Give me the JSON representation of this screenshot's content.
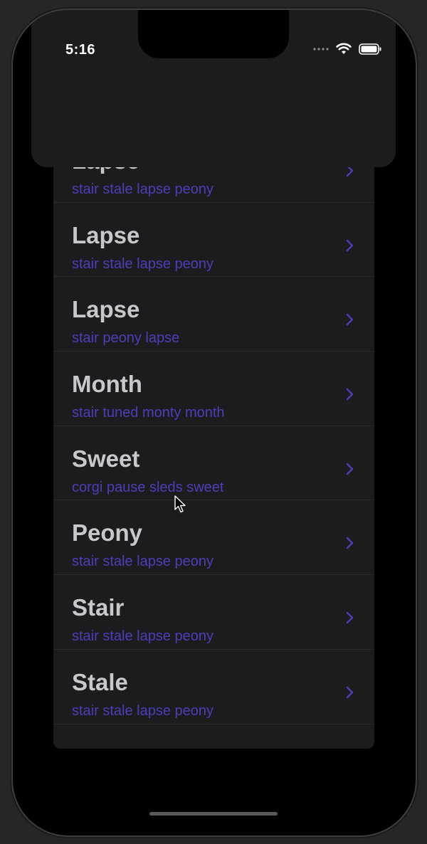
{
  "status_bar": {
    "time": "5:16",
    "icons": [
      "cellular-icon",
      "wifi-icon",
      "battery-icon"
    ]
  },
  "list": {
    "items": [
      {
        "title": "Lapse",
        "subtitle": "stair stale lapse peony"
      },
      {
        "title": "Lapse",
        "subtitle": "stair stale lapse peony"
      },
      {
        "title": "Lapse",
        "subtitle": "stair peony lapse"
      },
      {
        "title": "Month",
        "subtitle": "stair tuned monty month"
      },
      {
        "title": "Sweet",
        "subtitle": "corgi pause sleds sweet"
      },
      {
        "title": "Peony",
        "subtitle": "stair stale lapse peony"
      },
      {
        "title": "Stair",
        "subtitle": "stair stale lapse peony"
      },
      {
        "title": "Stale",
        "subtitle": "stair stale lapse peony"
      }
    ]
  },
  "colors": {
    "background": "#000000",
    "panel": "#1c1c1e",
    "title_text": "#c7c7cc",
    "subtitle_text": "#4a3fb8",
    "chevron": "#4a3fb8"
  }
}
